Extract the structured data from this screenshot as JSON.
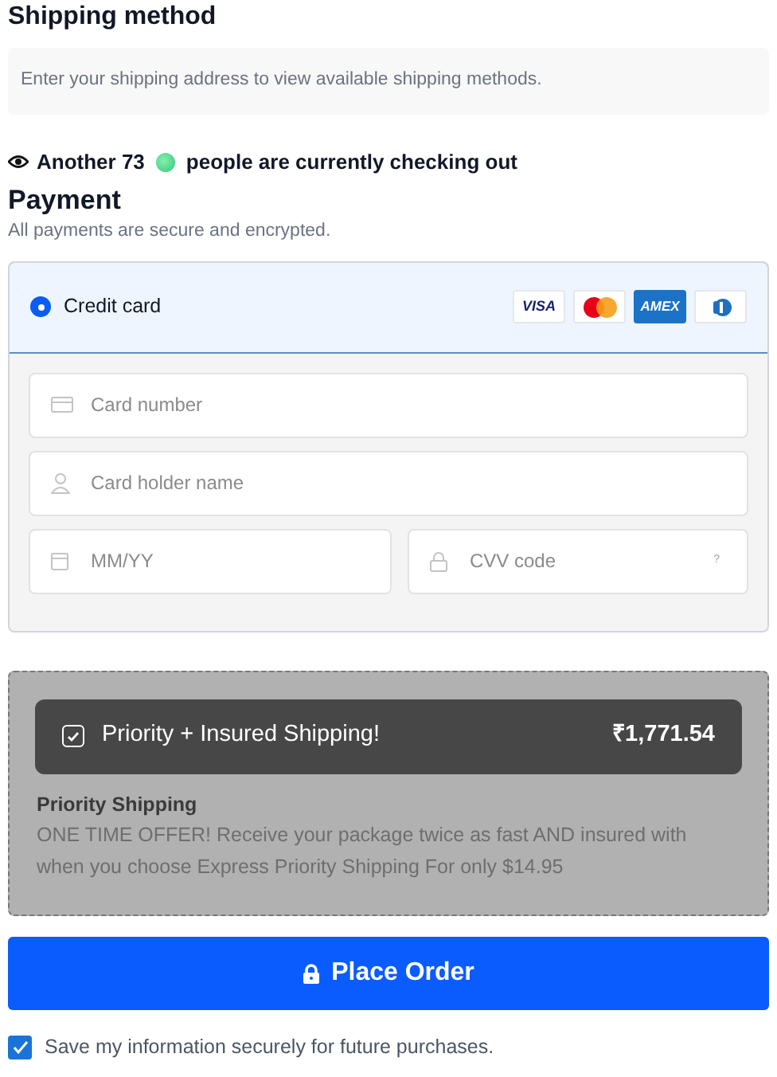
{
  "shipping": {
    "title": "Shipping method",
    "notice": "Enter your shipping address to view available shipping methods."
  },
  "live_counter": {
    "prefix": "Another 73",
    "suffix": "people are currently checking out"
  },
  "payment": {
    "title": "Payment",
    "subtitle": "All payments are secure and encrypted.",
    "methods": [
      {
        "label": "Credit card",
        "selected": true
      }
    ],
    "card_brands": [
      {
        "kind": "visa",
        "label": "VISA"
      },
      {
        "kind": "mastercard"
      },
      {
        "kind": "amex",
        "label": "AMEX"
      },
      {
        "kind": "diners"
      }
    ],
    "fields": [
      {
        "kind": "card",
        "placeholder": "Card number"
      },
      {
        "kind": "person",
        "placeholder": "Card holder name"
      },
      {
        "kind": "calendar",
        "placeholder": "MM/YY"
      },
      {
        "kind": "lock",
        "placeholder": "CVV code",
        "hint": "?"
      }
    ]
  },
  "upsell": {
    "label": "Priority + Insured Shipping!",
    "checked": true,
    "price": "₹1,771.54",
    "title": "Priority Shipping",
    "description": "ONE TIME OFFER! Receive your package twice as fast AND insured with when you choose Express Priority Shipping For only $14.95"
  },
  "place_order": {
    "label": "Place Order"
  },
  "save_info": {
    "label": "Save my information securely for future purchases.",
    "checked": true
  }
}
